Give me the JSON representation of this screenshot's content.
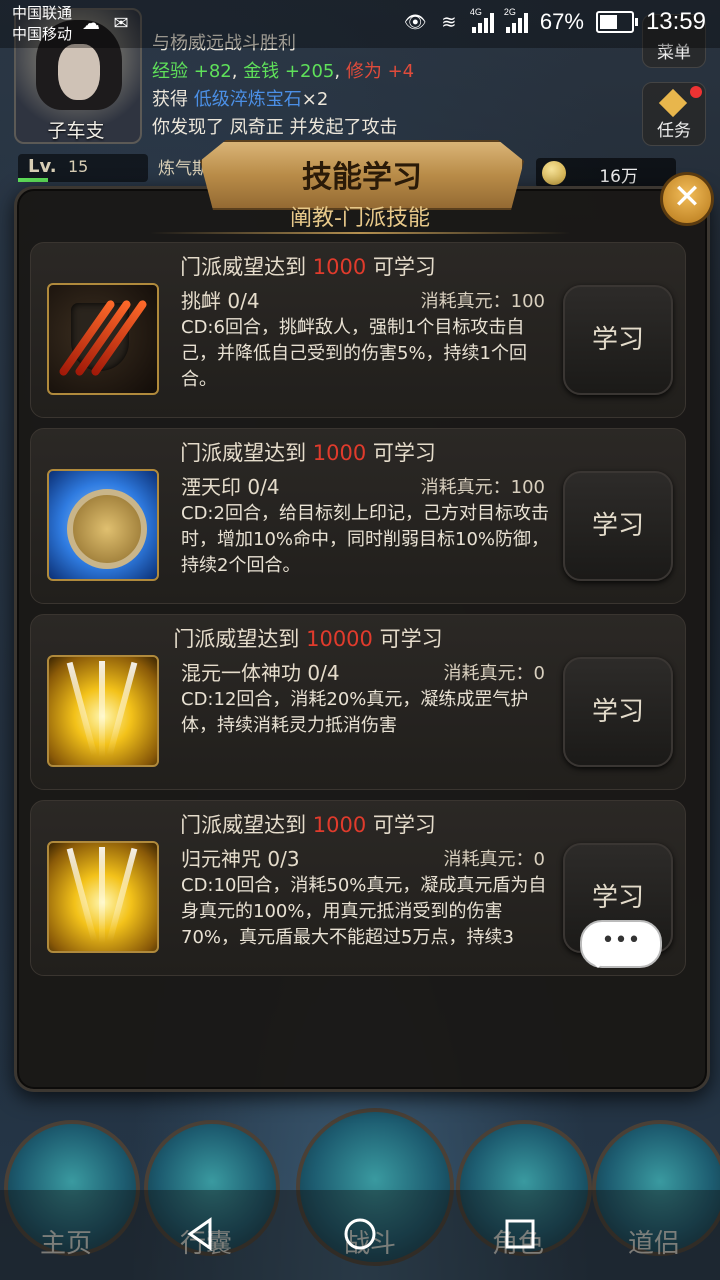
{
  "status_bar": {
    "carrier1": "中国联通",
    "carrier2": "中国移动",
    "net_4g": "4G",
    "net_2g": "2G",
    "battery_pct": "67%",
    "battery_level": 0.67,
    "time": "13:59"
  },
  "hud": {
    "player_name": "子车支",
    "log_line1": "与杨威远战斗胜利",
    "log_exp_label": "经验",
    "log_exp_val": "+82",
    "log_money_label": "金钱",
    "log_money_val": "+205",
    "log_cult_label": "修为",
    "log_cult_val": "+4",
    "log_get_prefix": "获得 ",
    "log_item": "低级淬炼宝石",
    "log_item_count": "×2",
    "log_line4": "你发现了 凤奇正 并发起了攻击",
    "menu_label": "菜单",
    "task_label": "任务",
    "lv_label": "Lv.",
    "lv_value": "15",
    "lianqi_label": "炼气期",
    "money": "16万"
  },
  "dialog": {
    "title": "技能学习",
    "subtitle": "阐教-门派技能",
    "close_symbol": "✕",
    "skills": [
      {
        "req_prefix": "门派威望达到 ",
        "req_num": "1000",
        "req_suffix": " 可学习",
        "name": "挑衅 0/4",
        "cost": "消耗真元：100",
        "desc": "CD:6回合，挑衅敌人，强制1个目标攻击自己，并降低自己受到的伤害5%，持续1个回合。",
        "button": "学习"
      },
      {
        "req_prefix": "门派威望达到 ",
        "req_num": "1000",
        "req_suffix": " 可学习",
        "name": "湮天印 0/4",
        "cost": "消耗真元：100",
        "desc": "CD:2回合，给目标刻上印记，己方对目标攻击时，增加10%命中，同时削弱目标10%防御，持续2个回合。",
        "button": "学习"
      },
      {
        "req_prefix": "门派威望达到 ",
        "req_num": "10000",
        "req_suffix": " 可学习",
        "name": "混元一体神功 0/4",
        "cost": "消耗真元：0",
        "desc": "CD:12回合，消耗20%真元，凝练成罡气护体，持续消耗灵力抵消伤害",
        "button": "学习"
      },
      {
        "req_prefix": "门派威望达到 ",
        "req_num": "1000",
        "req_suffix": " 可学习",
        "name": "归元神咒 0/3",
        "cost": "消耗真元：0",
        "desc": "CD:10回合，消耗50%真元，凝成真元盾为自身真元的100%，用真元抵消受到的伤害70%，真元盾最大不能超过5万点，持续3",
        "button": "学习"
      }
    ]
  },
  "chat_bubble": "•••",
  "bottom_nav": [
    "主页",
    "行囊",
    "战斗",
    "角色",
    "道侣"
  ]
}
